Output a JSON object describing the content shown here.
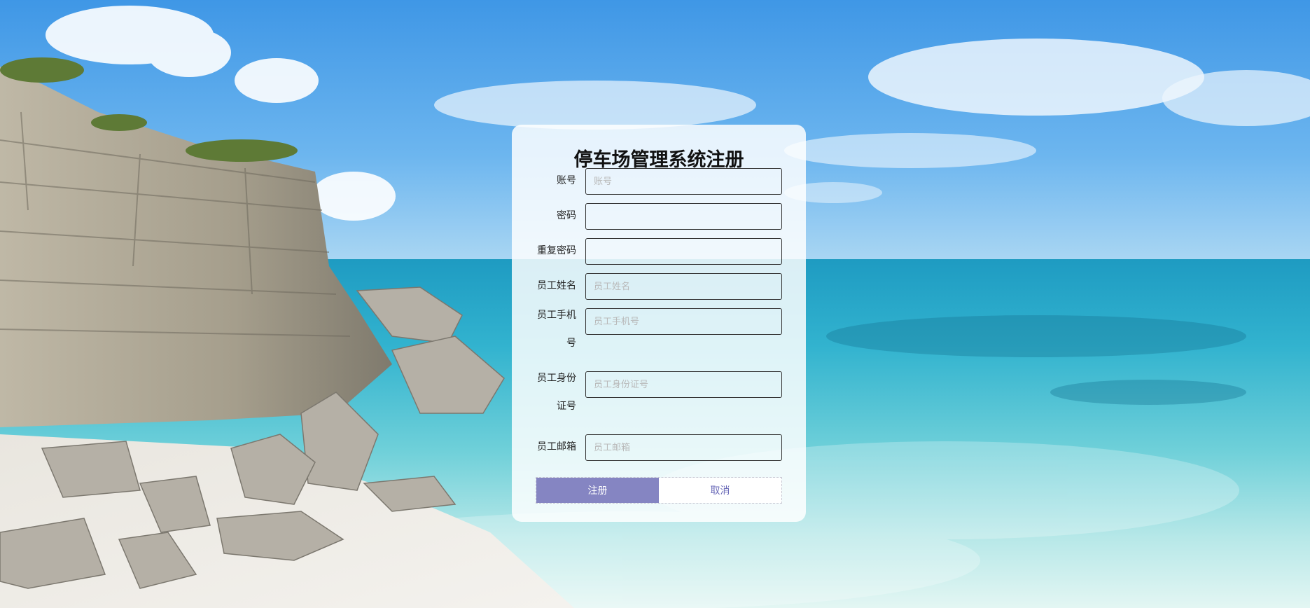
{
  "page": {
    "title": "停车场管理系统注册"
  },
  "form": {
    "fields": [
      {
        "label": "账号",
        "placeholder": "账号",
        "value": "",
        "type": "text"
      },
      {
        "label": "密码",
        "placeholder": "",
        "value": "",
        "type": "password"
      },
      {
        "label": "重复密码",
        "placeholder": "",
        "value": "",
        "type": "password"
      },
      {
        "label": "员工姓名",
        "placeholder": "员工姓名",
        "value": "",
        "type": "text"
      },
      {
        "label": "员工手机号",
        "placeholder": "员工手机号",
        "value": "",
        "type": "text"
      },
      {
        "label": "员工身份证号",
        "placeholder": "员工身份证号",
        "value": "",
        "type": "text"
      },
      {
        "label": "员工邮箱",
        "placeholder": "员工邮箱",
        "value": "",
        "type": "text"
      }
    ],
    "register_label": "注册",
    "cancel_label": "取消"
  },
  "colors": {
    "register_button": "#8585c2",
    "cancel_text": "#6a6ab8",
    "card_background": "#ffffff"
  }
}
